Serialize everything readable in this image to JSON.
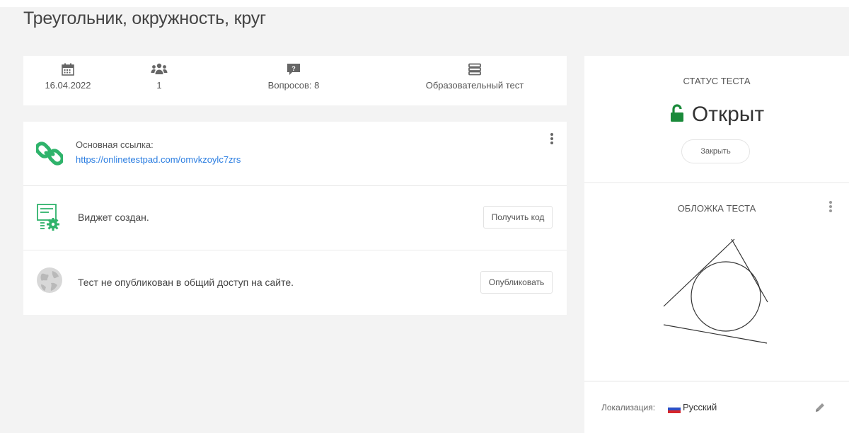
{
  "page": {
    "title": "Треугольник, окружность, круг"
  },
  "info": {
    "date": "16.04.2022",
    "participants": "1",
    "questions": "Вопросов: 8",
    "type": "Образовательный тест"
  },
  "links": {
    "main_link_label": "Основная ссылка:",
    "main_link_url": "https://onlinetestpad.com/omvkzoylc7zrs",
    "widget_text": "Виджет создан.",
    "get_code_label": "Получить код",
    "publish_text": "Тест не опубликован в общий доступ на сайте.",
    "publish_label": "Опубликовать"
  },
  "status": {
    "title": "СТАТУС ТЕСТА",
    "value": "Открыт",
    "close_label": "Закрыть"
  },
  "cover": {
    "title": "ОБЛОЖКА ТЕСТА"
  },
  "locale": {
    "label": "Локализация:",
    "value": "Русский"
  },
  "colors": {
    "accent_green": "#2fb36b",
    "link_blue": "#2a7de1",
    "status_green": "#1a8a3a"
  },
  "icons": [
    "calendar-icon",
    "users-icon",
    "question-icon",
    "layers-icon",
    "link-icon",
    "widget-icon",
    "globe-icon",
    "unlock-icon",
    "edit-icon",
    "flag-ru-icon",
    "more-vert-icon"
  ]
}
